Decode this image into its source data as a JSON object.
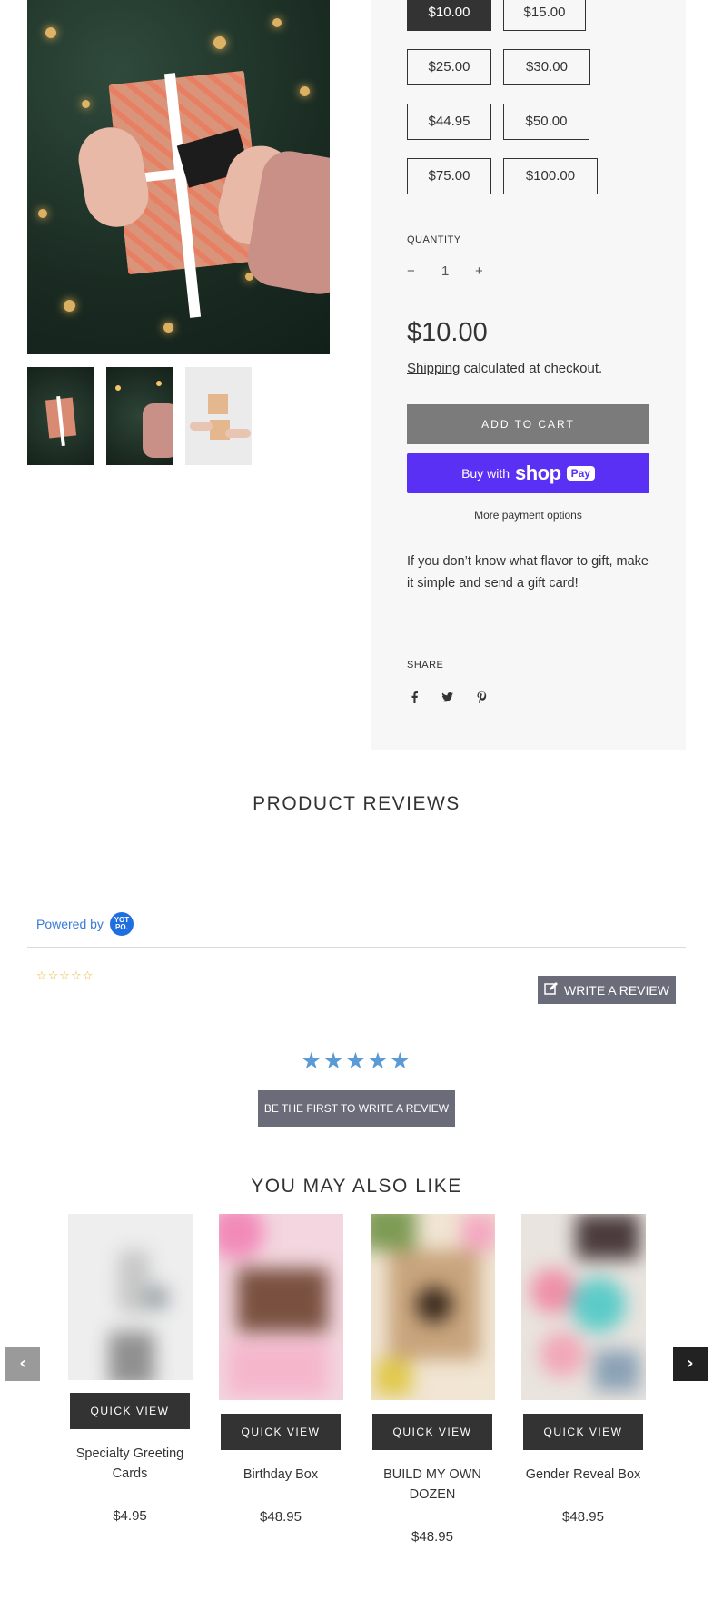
{
  "gallery": {
    "main_image_alt": "Gift card wrapped present",
    "thumbnails": [
      "thumb-1",
      "thumb-2",
      "thumb-3"
    ]
  },
  "amounts": {
    "options": [
      "$10.00",
      "$15.00",
      "$25.00",
      "$30.00",
      "$44.95",
      "$50.00",
      "$75.00",
      "$100.00"
    ],
    "selected": "$10.00"
  },
  "quantity": {
    "label": "QUANTITY",
    "minus": "−",
    "value": "1",
    "plus": "+"
  },
  "price": "$10.00",
  "shipping": {
    "link": "Shipping",
    "text": " calculated at checkout."
  },
  "buttons": {
    "add_to_cart": "ADD TO CART",
    "buy_with": "Buy with",
    "shop": "shop",
    "pay": "Pay",
    "more_payment": "More payment options"
  },
  "description": "If you don’t know what flavor to gift, make it simple and send a gift card!",
  "share": {
    "label": "SHARE",
    "icons": [
      "facebook-icon",
      "twitter-icon",
      "pinterest-icon"
    ]
  },
  "reviews": {
    "heading": "PRODUCT REVIEWS",
    "powered_by": "Powered by",
    "badge": "YOT PO.",
    "empty_stars": "☆☆☆☆☆",
    "write_review": "WRITE A REVIEW",
    "big_stars": "★★★★★",
    "first_review": "BE THE FIRST TO WRITE A REVIEW"
  },
  "also_like": {
    "heading": "YOU MAY ALSO LIKE",
    "quick_view": "QUICK VIEW",
    "products": [
      {
        "name": "Specialty Greeting Cards",
        "price": "$4.95"
      },
      {
        "name": "Birthday Box",
        "price": "$48.95"
      },
      {
        "name": "BUILD MY OWN DOZEN",
        "price": "$48.95"
      },
      {
        "name": "Gender Reveal Box",
        "price": "$48.95"
      }
    ]
  },
  "colors": {
    "selected_amount": "#333333",
    "add_to_cart": "#7b7b7b",
    "shop_pay": "#5a31f4",
    "yotpo_blue": "#3a7bd5",
    "star_gold": "#e9b630",
    "star_blue": "#5b9bd5",
    "review_button": "#6a6c79"
  }
}
